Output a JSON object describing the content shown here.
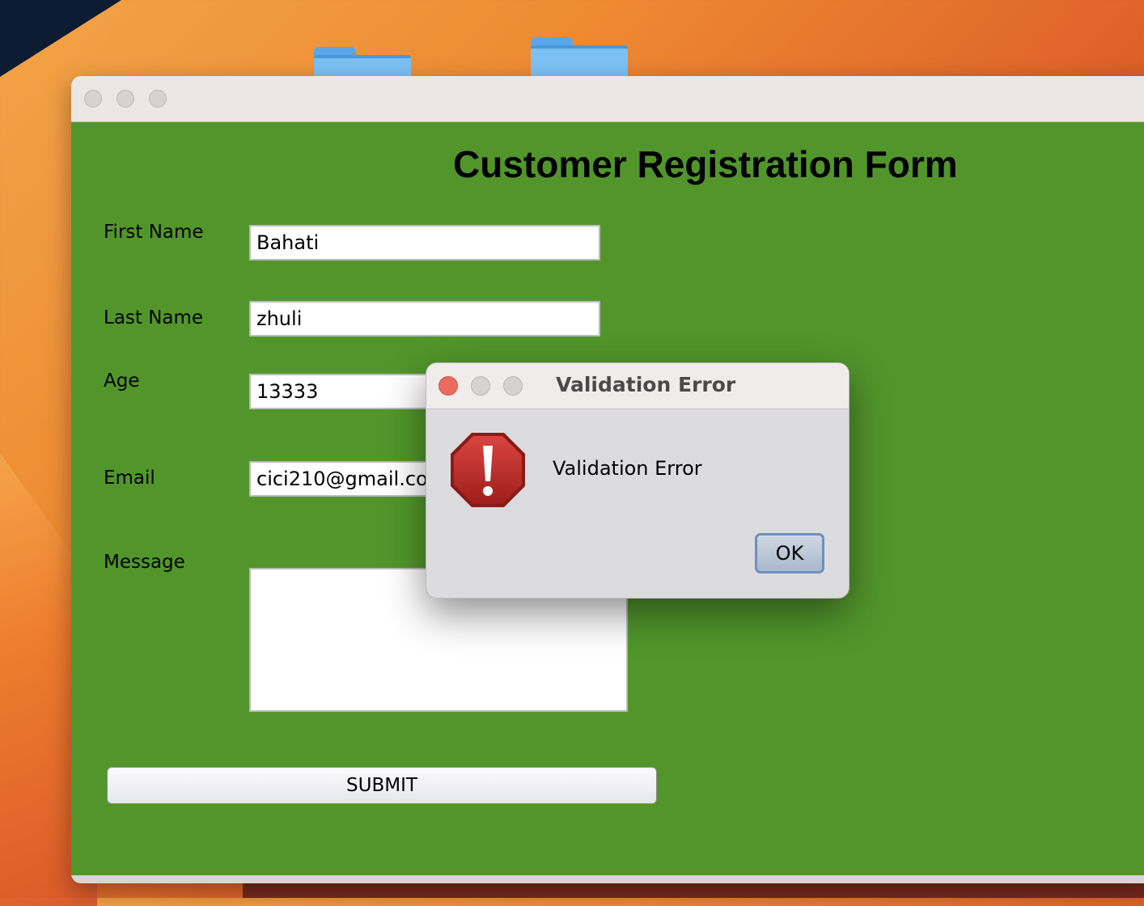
{
  "form": {
    "title": "Customer Registration Form",
    "first_name_label": "First Name",
    "first_name_value": "Bahati",
    "last_name_label": "Last Name",
    "last_name_value": "zhuli",
    "age_label": "Age",
    "age_value": "13333",
    "email_label": "Email",
    "email_value": "cici210@gmail.con",
    "message_label": "Message",
    "message_value": "",
    "submit_label": "SUBMIT"
  },
  "dialog": {
    "title": "Validation Error",
    "message": "Validation Error",
    "ok_label": "OK",
    "icon": "error-stop-icon"
  },
  "colors": {
    "form_background": "#52962b",
    "close_red": "#ec6a5e"
  }
}
